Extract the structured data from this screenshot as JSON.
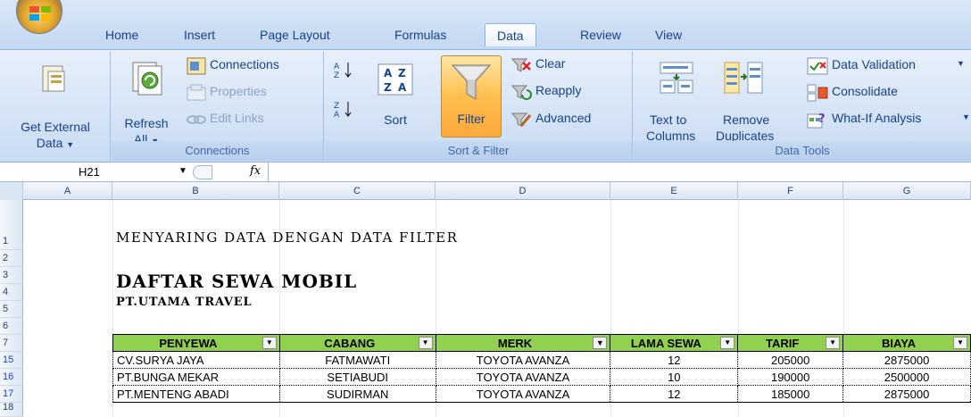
{
  "ribbon": {
    "tabs": [
      "Home",
      "Insert",
      "Page Layout",
      "Formulas",
      "Data",
      "Review",
      "View"
    ],
    "active_tab": "Data",
    "groups": {
      "get_external": {
        "line1": "Get External",
        "line2": "Data"
      },
      "connections": {
        "refresh_line1": "Refresh",
        "refresh_line2": "All",
        "connections": "Connections",
        "properties": "Properties",
        "edit_links": "Edit Links",
        "label": "Connections"
      },
      "sort_filter": {
        "sort": "Sort",
        "filter": "Filter",
        "clear": "Clear",
        "reapply": "Reapply",
        "advanced": "Advanced",
        "label": "Sort & Filter"
      },
      "data_tools": {
        "text_to_line1": "Text to",
        "text_to_line2": "Columns",
        "remove_line1": "Remove",
        "remove_line2": "Duplicates",
        "data_validation": "Data Validation",
        "consolidate": "Consolidate",
        "what_if": "What-If Analysis",
        "label": "Data Tools"
      }
    }
  },
  "formula_bar": {
    "name_box": "H21",
    "fx": "fx"
  },
  "columns": [
    "A",
    "B",
    "C",
    "D",
    "E",
    "F",
    "G"
  ],
  "rows": [
    "1",
    "2",
    "3",
    "4",
    "5",
    "6",
    "7",
    "15",
    "16",
    "17",
    "18"
  ],
  "sheet": {
    "title": "MENYARING DATA DENGAN DATA FILTER",
    "list_title": "DAFTAR SEWA MOBIL",
    "list_subtitle": "PT.UTAMA TRAVEL"
  },
  "table": {
    "headers": [
      "PENYEWA",
      "CABANG",
      "MERK",
      "LAMA SEWA",
      "TARIF",
      "BIAYA"
    ],
    "filtered_column": "MERK",
    "rows": [
      [
        "CV.SURYA JAYA",
        "FATMAWATI",
        "TOYOTA AVANZA",
        "12",
        "205000",
        "2875000"
      ],
      [
        "PT.BUNGA MEKAR",
        "SETIABUDI",
        "TOYOTA AVANZA",
        "10",
        "190000",
        "2500000"
      ],
      [
        "PT.MENTENG ABADI",
        "SUDIRMAN",
        "TOYOTA AVANZA",
        "12",
        "185000",
        "2875000"
      ]
    ]
  },
  "colors": {
    "header_fill": "#92d050",
    "filtered_row_number": "#1a3fd6",
    "filter_button": "#fdbf4f"
  }
}
